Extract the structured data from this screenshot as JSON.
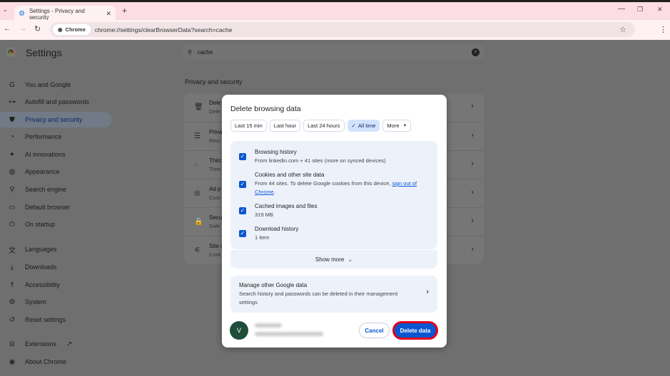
{
  "browser": {
    "tab_title": "Settings - Privacy and security",
    "chip_label": "Chrome",
    "url": "chrome://settings/clearBrowserData?search=cache"
  },
  "settings": {
    "title": "Settings",
    "search_value": "cache",
    "section_title": "Privacy and security",
    "sidebar": [
      {
        "label": "You and Google",
        "icon": "google-g-icon"
      },
      {
        "label": "Autofill and passwords",
        "icon": "key-icon"
      },
      {
        "label": "Privacy and security",
        "icon": "shield-icon",
        "active": true
      },
      {
        "label": "Performance",
        "icon": "speedometer-icon"
      },
      {
        "label": "AI innovations",
        "icon": "sparkle-icon"
      },
      {
        "label": "Appearance",
        "icon": "palette-icon"
      },
      {
        "label": "Search engine",
        "icon": "search-icon"
      },
      {
        "label": "Default browser",
        "icon": "browser-icon"
      },
      {
        "label": "On startup",
        "icon": "power-icon"
      },
      {
        "label": "Languages",
        "icon": "translate-icon"
      },
      {
        "label": "Downloads",
        "icon": "download-icon"
      },
      {
        "label": "Accessibility",
        "icon": "accessibility-icon"
      },
      {
        "label": "System",
        "icon": "wrench-icon"
      },
      {
        "label": "Reset settings",
        "icon": "reset-icon"
      },
      {
        "label": "Extensions",
        "icon": "extension-icon"
      },
      {
        "label": "About Chrome",
        "icon": "chrome-icon"
      }
    ],
    "rows": [
      {
        "title": "Dele",
        "sub": "Dele",
        "icon": "trash-icon"
      },
      {
        "title": "Priva",
        "sub": "Revi",
        "icon": "sliders-icon"
      },
      {
        "title": "Thirc",
        "sub": "Thirc",
        "icon": "cookie-icon"
      },
      {
        "title": "Ad p",
        "sub": "Cust",
        "icon": "ad-privacy-icon"
      },
      {
        "title": "Secu",
        "sub": "Safe",
        "icon": "lock-icon"
      },
      {
        "title": "Site s",
        "sub": "Cont",
        "icon": "site-settings-icon"
      }
    ]
  },
  "dialog": {
    "title": "Delete browsing data",
    "time_ranges": [
      "Last 15 min",
      "Last hour",
      "Last 24 hours",
      "All time",
      "More"
    ],
    "selected_range": "All time",
    "options": [
      {
        "label": "Browsing history",
        "sub": "From linkedin.com + 41 sites (more on synced devices)",
        "checked": true
      },
      {
        "label": "Cookies and other site data",
        "sub": "From 44 sites. To delete Google cookies from this device, ",
        "link": "sign out of Chrome",
        "sub_end": ".",
        "checked": true
      },
      {
        "label": "Cached images and files",
        "sub": "319 MB",
        "checked": true
      },
      {
        "label": "Download history",
        "sub": "1 item",
        "checked": true
      }
    ],
    "show_more": "Show more",
    "manage_title": "Manage other Google data",
    "manage_sub": "Search history and passwords can be deleted in their management settings",
    "avatar_letter": "V",
    "cancel": "Cancel",
    "delete": "Delete data",
    "colors": {
      "primary": "#0b57d0",
      "highlight": "#e0001b"
    }
  }
}
